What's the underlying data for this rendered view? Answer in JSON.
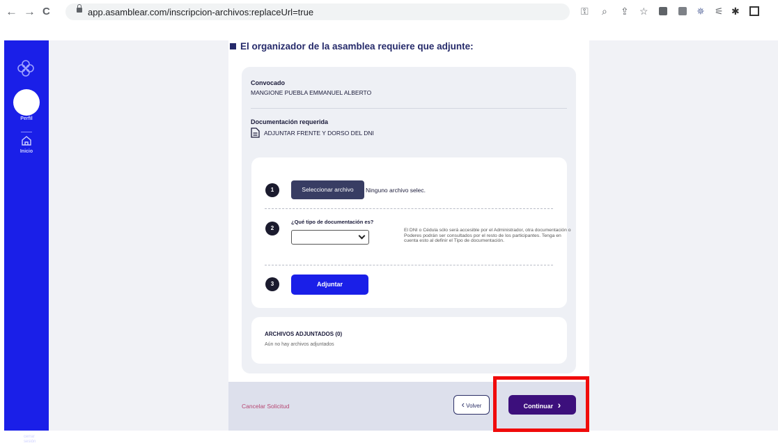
{
  "browser": {
    "url": "app.asamblear.com/inscripcion-archivos:replaceUrl=true",
    "back": "←",
    "forward": "→",
    "reload": "C",
    "toolbar_icons": [
      "key-icon",
      "zoom-icon",
      "share-icon",
      "star-icon",
      "ext-icon",
      "ext-icon",
      "ext-icon",
      "ext-icon",
      "puzzle-icon",
      "window-icon"
    ]
  },
  "sidebar": {
    "profile_label": "Perfil",
    "home_label": "Inicio",
    "logout_line1": "cerrar",
    "logout_line2": "sesión",
    "color": "#1a1fe8"
  },
  "page": {
    "heading": "El organizador de la asamblea requiere que adjunte:",
    "convocado_label": "Convocado",
    "convocado_name": "MANGIONE PUEBLA EMMANUEL ALBERTO",
    "doc_required_label": "Documentación requerida",
    "doc_required_item": "ADJUNTAR FRENTE Y DORSO DEL DNI",
    "steps": {
      "s1": "1",
      "s2": "2",
      "s3": "3"
    },
    "select_file_button": "Seleccionar archivo",
    "no_file_text": "Ninguno archivo selec.",
    "doc_type_question": "¿Qué tipo de documentación es?",
    "doc_type_selected": "",
    "doc_type_note": "El DNI o Cédula sólo será accesible por el Administrador, otra documentación o Poderes podrán ser consultados por el resto de los participantes. Tenga en cuenta esto al definir el Tipo de documentación.",
    "attach_button": "Adjuntar",
    "attached_title": "ARCHIVOS ADJUNTADOS (0)",
    "attached_empty": "Aún no hay archivos adjuntados"
  },
  "footer": {
    "cancel": "Cancelar Solicitud",
    "back_button": "Volver",
    "continue_button": "Continuar",
    "back_chevron": "‹",
    "continue_chevron": "›"
  },
  "colors": {
    "highlight": "#f00b0b",
    "continue_bg": "#3c0f7c",
    "primary_blue": "#1a1fe8"
  }
}
